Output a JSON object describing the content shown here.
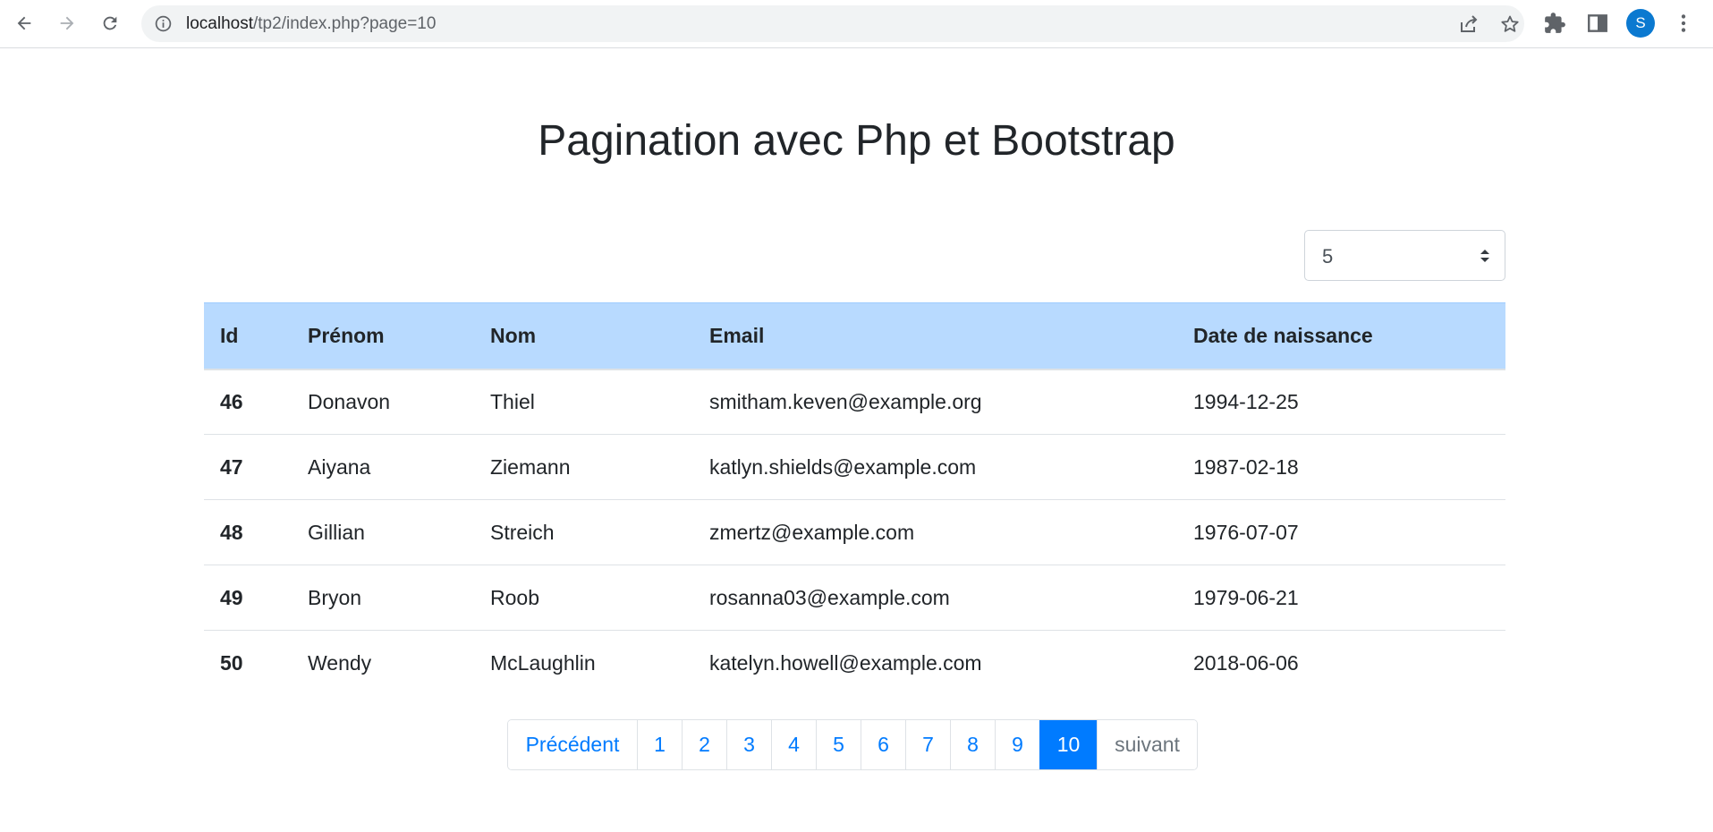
{
  "browser": {
    "url_host": "localhost",
    "url_path": "/tp2/index.php?page=10",
    "profile_initial": "S",
    "icons": [
      "back-icon",
      "forward-icon",
      "reload-icon",
      "info-icon",
      "share-icon",
      "star-icon",
      "extensions-icon",
      "side-panel-icon",
      "menu-icon"
    ]
  },
  "page": {
    "title": "Pagination avec Php et Bootstrap"
  },
  "per_page_select": {
    "value": "5"
  },
  "table": {
    "headers": [
      "Id",
      "Prénom",
      "Nom",
      "Email",
      "Date de naissance"
    ],
    "rows": [
      [
        "46",
        "Donavon",
        "Thiel",
        "smitham.keven@example.org",
        "1994-12-25"
      ],
      [
        "47",
        "Aiyana",
        "Ziemann",
        "katlyn.shields@example.com",
        "1987-02-18"
      ],
      [
        "48",
        "Gillian",
        "Streich",
        "zmertz@example.com",
        "1976-07-07"
      ],
      [
        "49",
        "Bryon",
        "Roob",
        "rosanna03@example.com",
        "1979-06-21"
      ],
      [
        "50",
        "Wendy",
        "McLaughlin",
        "katelyn.howell@example.com",
        "2018-06-06"
      ]
    ]
  },
  "pagination": {
    "prev_label": "Précédent",
    "pages": [
      "1",
      "2",
      "3",
      "4",
      "5",
      "6",
      "7",
      "8",
      "9",
      "10"
    ],
    "current": "10",
    "next_label": "suivant"
  },
  "colors": {
    "header_bg": "#b8daff",
    "link": "#007bff",
    "active_bg": "#007bff",
    "avatar": "#0b79d0"
  }
}
